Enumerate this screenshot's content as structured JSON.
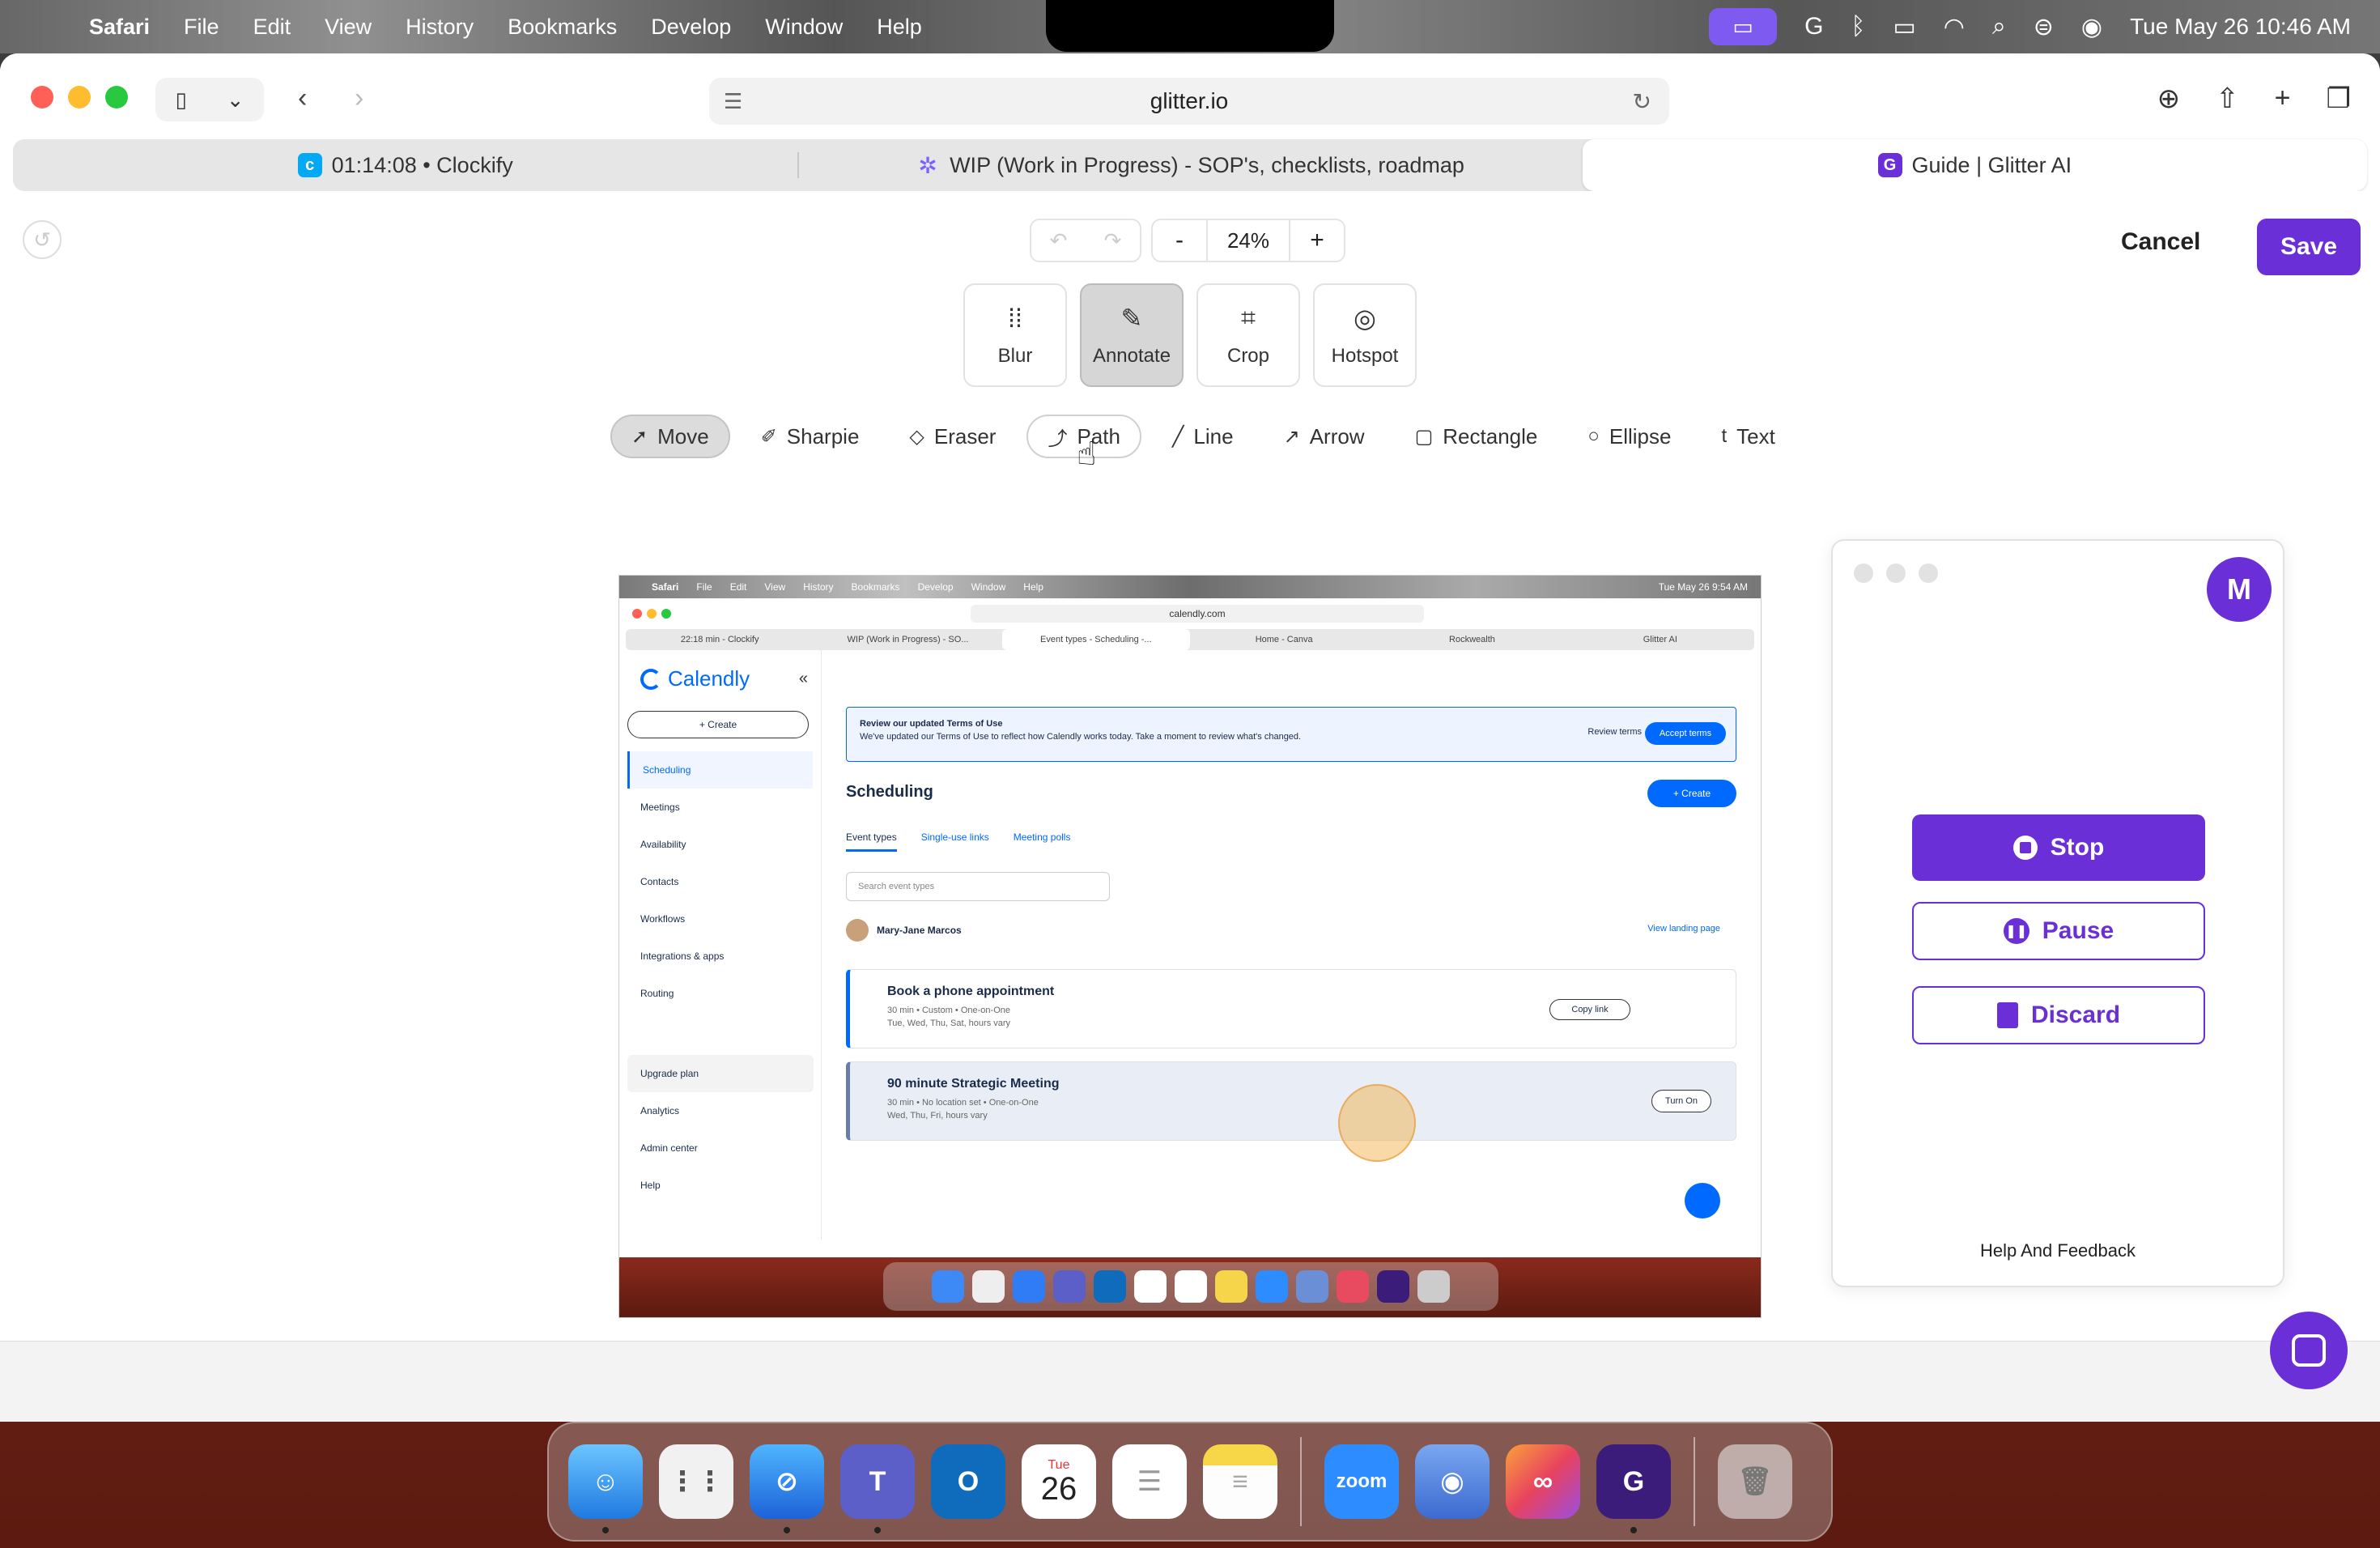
{
  "menubar": {
    "app_name": "Safari",
    "menus": [
      "File",
      "Edit",
      "View",
      "History",
      "Bookmarks",
      "Develop",
      "Window",
      "Help"
    ],
    "clock": "Tue May 26  10:46 AM"
  },
  "browser": {
    "url": "glitter.io",
    "tabs": [
      {
        "label": "01:14:08 • Clockify",
        "icon": "clockify-icon",
        "color": "#03a9f4"
      },
      {
        "label": "WIP (Work in Progress) - SOP's, checklists, roadmap",
        "icon": "sparkle-icon",
        "color": "#7b61ff"
      },
      {
        "label": "Guide | Glitter AI",
        "icon": "glitter-icon",
        "color": "#6a2fd6"
      }
    ],
    "active_tab_index": 2
  },
  "editor": {
    "zoom": "24%",
    "zoom_minus": "-",
    "zoom_plus": "+",
    "cancel_label": "Cancel",
    "save_label": "Save",
    "modes": [
      {
        "label": "Blur",
        "icon": "blur-icon"
      },
      {
        "label": "Annotate",
        "icon": "pencil-icon"
      },
      {
        "label": "Crop",
        "icon": "crop-icon"
      },
      {
        "label": "Hotspot",
        "icon": "hotspot-icon"
      }
    ],
    "active_mode": "Annotate",
    "tools": [
      {
        "label": "Move",
        "icon": "move-icon"
      },
      {
        "label": "Sharpie",
        "icon": "sharpie-icon"
      },
      {
        "label": "Eraser",
        "icon": "eraser-icon"
      },
      {
        "label": "Path",
        "icon": "path-icon"
      },
      {
        "label": "Line",
        "icon": "line-icon"
      },
      {
        "label": "Arrow",
        "icon": "arrow-icon"
      },
      {
        "label": "Rectangle",
        "icon": "rectangle-icon"
      },
      {
        "label": "Ellipse",
        "icon": "ellipse-icon"
      },
      {
        "label": "Text",
        "icon": "text-icon"
      }
    ],
    "active_tool": "Move",
    "hovered_tool": "Path"
  },
  "screenshot": {
    "menus": [
      "Safari",
      "File",
      "Edit",
      "View",
      "History",
      "Bookmarks",
      "Develop",
      "Window",
      "Help"
    ],
    "clock": "Tue May 26  9:54 AM",
    "url": "calendly.com",
    "tabs": [
      "22:18 min - Clockify",
      "WIP (Work in Progress) - SO...",
      "Event types - Scheduling -...",
      "Home - Canva",
      "Rockwealth",
      "Glitter AI"
    ],
    "brand": "Calendly",
    "create_label": "+ Create",
    "nav": [
      "Scheduling",
      "Meetings",
      "Availability",
      "Contacts",
      "Workflows",
      "Integrations & apps",
      "Routing"
    ],
    "bottom_nav": [
      "Upgrade plan",
      "Analytics",
      "Admin center",
      "Help"
    ],
    "banner_title": "Review our updated Terms of Use",
    "banner_text": "We've updated our Terms of Use to reflect how Calendly works today. Take a moment to review what's changed.",
    "review_terms": "Review terms",
    "accept_terms": "Accept terms",
    "heading": "Scheduling",
    "create_button": "+ Create",
    "subtabs": [
      "Event types",
      "Single-use links",
      "Meeting polls"
    ],
    "search_placeholder": "Search event types",
    "owner": "Mary-Jane Marcos",
    "landing_link": "View landing page",
    "events": [
      {
        "title": "Book a phone appointment",
        "meta": "30 min • Custom • One-on-One",
        "days": "Tue, Wed, Thu, Sat, hours vary",
        "action": "Copy link"
      },
      {
        "title": "90 minute Strategic Meeting",
        "meta": "30 min • No location set • One-on-One",
        "days": "Wed, Thu, Fri, hours vary",
        "action": "Turn On"
      }
    ]
  },
  "recorder": {
    "avatar_letter": "M",
    "stop_label": "Stop",
    "pause_label": "Pause",
    "discard_label": "Discard",
    "help_label": "Help And Feedback",
    "accent": "#6a2fd6"
  },
  "dock": {
    "apps": [
      "Finder",
      "Launchpad",
      "Safari",
      "Teams",
      "Outlook",
      "Calendar",
      "Reminders",
      "Notes",
      "Zoom",
      "Screenshot",
      "Creative Cloud",
      "Glitter",
      "Trash"
    ],
    "calendar_month": "Tue",
    "calendar_day": "26",
    "zoom_label": "zoom"
  }
}
